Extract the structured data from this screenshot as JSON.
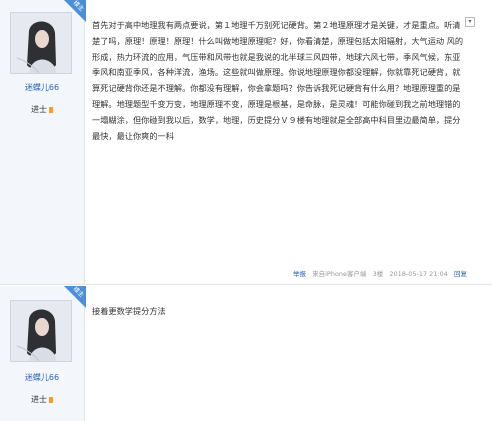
{
  "posts": [
    {
      "user": {
        "name": "迷蝶儿66",
        "level": "进士",
        "badge": "楼主"
      },
      "content": "首先对于高中地理我有两点要说，第１地理千万别死记硬背。第２地理原理才是关键，才是重点。听清楚了吗，原理！原理！原理！什么叫做地理原理呢？好，你看清楚，原理包括太阳辐射，大气运动 风的形成，热力环流的应用，气压带和风带也就是我说的北半球三风四带，地球六风七带，季风气候，东亚季风和南亚季风，各种洋流，渔场。这些就叫做原理。你说地理原理你都没理解，你就靠死记硬背，就算死记硬背你还是不理解。你都没有理解，你会拿题吗？你告诉我死记硬背有什么用？地理原理重的是理解。地理题型千变万变，地理原理不变，原理是根基，是命脉，是灵魂！可能你碰到我之前地理错的一塌糊涂，但你碰到我以后，数学，地理，历史提分Ｖ９楼有地理就是全部高中科目里边最简单，提分最快，最让你爽的一科",
      "meta": {
        "report": "举报",
        "source": "来自iPhone客户端",
        "floor": "3楼",
        "time": "2018-05-17 21:04",
        "reply": "回复"
      }
    },
    {
      "user": {
        "name": "迷蝶儿66",
        "level": "进士",
        "badge": "楼主"
      },
      "content": "接着更数学提分方法"
    }
  ],
  "icons": {
    "dropdown": "chevron-down-icon"
  },
  "colors": {
    "badge": "#4b8fd8",
    "link": "#2d64b3",
    "sidebar": "#f3f6fb"
  }
}
